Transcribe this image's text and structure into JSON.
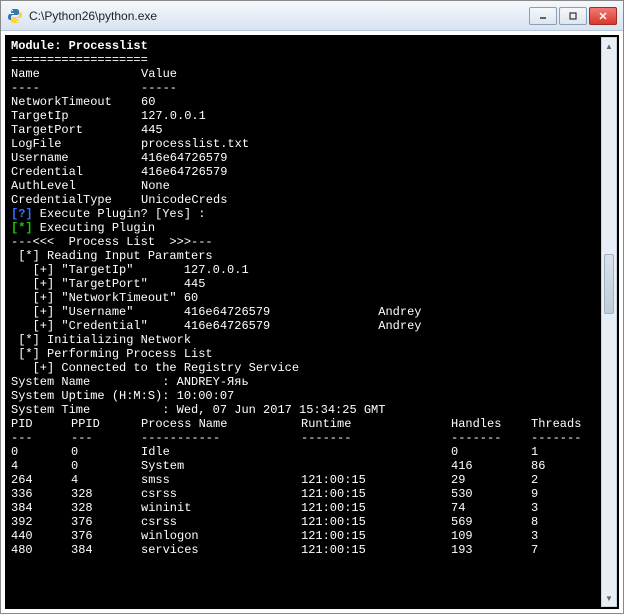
{
  "window": {
    "title": "C:\\Python26\\python.exe"
  },
  "module": {
    "header": "Module: Processlist",
    "divider": "==================="
  },
  "config_header": {
    "name": "Name",
    "value": "Value"
  },
  "config_divider": {
    "name": "----",
    "value": "-----"
  },
  "config": [
    {
      "name": "NetworkTimeout",
      "value": "60"
    },
    {
      "name": "TargetIp",
      "value": "127.0.0.1"
    },
    {
      "name": "TargetPort",
      "value": "445"
    },
    {
      "name": "LogFile",
      "value": "processlist.txt"
    },
    {
      "name": "Username",
      "value": "416e64726579"
    },
    {
      "name": "Credential",
      "value": "416e64726579"
    },
    {
      "name": "AuthLevel",
      "value": "None"
    },
    {
      "name": "CredentialType",
      "value": "UnicodeCreds"
    }
  ],
  "prompt": {
    "marker": "[?]",
    "text": " Execute Plugin? [Yes] :"
  },
  "executing": {
    "marker": "[*]",
    "text": " Executing Plugin"
  },
  "proclist_banner": "---<<<  Process List  >>>---",
  "reading": {
    "header": " [*] Reading Input Paramters",
    "params": [
      {
        "label": "   [+] \"TargetIp\"       ",
        "value": "127.0.0.1",
        "extra": ""
      },
      {
        "label": "   [+] \"TargetPort\"     ",
        "value": "445",
        "extra": ""
      },
      {
        "label": "   [+] \"NetworkTimeout\" ",
        "value": "60",
        "extra": ""
      },
      {
        "label": "   [+] \"Username\"       ",
        "value": "416e64726579",
        "extra": "               Andrey"
      },
      {
        "label": "   [+] \"Credential\"     ",
        "value": "416e64726579",
        "extra": "               Andrey"
      }
    ]
  },
  "steps": [
    " [*] Initializing Network",
    " [*] Performing Process List",
    "   [+] Connected to the Registry Service"
  ],
  "system": {
    "name_label": "System Name          : ",
    "name_value": "ANDREY-Яяь",
    "uptime_label": "System Uptime (H:M:S): ",
    "uptime_value": "10:00:07",
    "time_label": "System Time          : ",
    "time_value": "Wed, 07 Jun 2017 15:34:25 GMT"
  },
  "table": {
    "headers": {
      "pid": "PID",
      "ppid": "PPID",
      "pname": "Process Name",
      "runtime": "Runtime",
      "handles": "Handles",
      "threads": "Threads"
    },
    "divs": {
      "pid": "---",
      "ppid": "---",
      "pname": "-----------",
      "runtime": "-------",
      "handles": "-------",
      "threads": "-------"
    },
    "rows": [
      {
        "pid": "0",
        "ppid": "0",
        "pname": "Idle",
        "runtime": "",
        "handles": "0",
        "threads": "1"
      },
      {
        "pid": "4",
        "ppid": "0",
        "pname": "System",
        "runtime": "",
        "handles": "416",
        "threads": "86"
      },
      {
        "pid": "264",
        "ppid": "4",
        "pname": "smss",
        "runtime": "121:00:15",
        "handles": "29",
        "threads": "2"
      },
      {
        "pid": "336",
        "ppid": "328",
        "pname": "csrss",
        "runtime": "121:00:15",
        "handles": "530",
        "threads": "9"
      },
      {
        "pid": "384",
        "ppid": "328",
        "pname": "wininit",
        "runtime": "121:00:15",
        "handles": "74",
        "threads": "3"
      },
      {
        "pid": "392",
        "ppid": "376",
        "pname": "csrss",
        "runtime": "121:00:15",
        "handles": "569",
        "threads": "8"
      },
      {
        "pid": "440",
        "ppid": "376",
        "pname": "winlogon",
        "runtime": "121:00:15",
        "handles": "109",
        "threads": "3"
      },
      {
        "pid": "480",
        "ppid": "384",
        "pname": "services",
        "runtime": "121:00:15",
        "handles": "193",
        "threads": "7"
      }
    ]
  }
}
